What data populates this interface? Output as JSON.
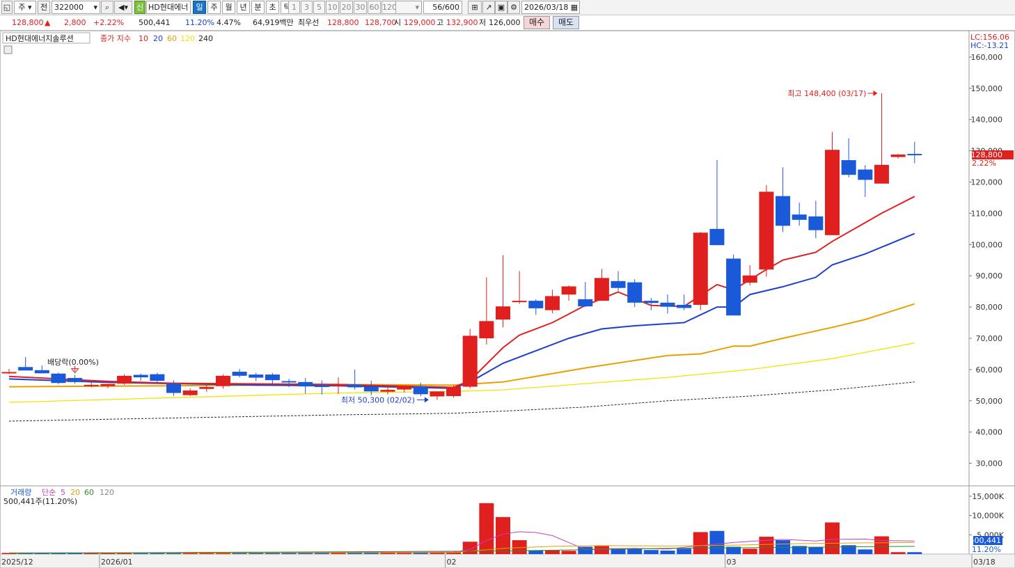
{
  "toolbar": {
    "market": "주",
    "prev_label": "전",
    "code": "322000",
    "new_badge": "신",
    "stock_name": "HD현대에너",
    "periods": [
      "일",
      "주",
      "월",
      "년",
      "분",
      "초",
      "틱"
    ],
    "active_period": "일",
    "intervals": [
      "1",
      "3",
      "5",
      "10",
      "20",
      "30",
      "60",
      "120"
    ],
    "count": "56/600",
    "date": "2026/03/18"
  },
  "quote": {
    "price": "128,800",
    "change": "2,800",
    "change_pct": "+2.22%",
    "volume": "500,441",
    "turnover_pct": "11.20%",
    "other_pct": "4.47%",
    "amount": "64,919백만",
    "best_bid_label": "최우선",
    "best_ask": "128,800",
    "best_bid": "128,700",
    "open_label": "시",
    "open": "129,000",
    "high_label": "고",
    "high": "132,900",
    "low_label": "저",
    "low": "126,000",
    "buy_label": "매수",
    "sell_label": "매도"
  },
  "chart_data": {
    "type": "candlestick",
    "title": "HD현대에너지솔루션",
    "ma_label": "종가 지수",
    "ma_periods": [
      "10",
      "20",
      "60",
      "120",
      "240"
    ],
    "ma_colors": [
      "#e0201e",
      "#1d3fd0",
      "#e8a000",
      "#f2e400",
      "#222222"
    ],
    "lc_label": "LC:156.06",
    "hc_label": "HC:-13.21",
    "current_price_label": "128,800",
    "current_pct_label": "2.22%",
    "y_ticks": [
      30000,
      40000,
      50000,
      60000,
      70000,
      80000,
      90000,
      100000,
      110000,
      120000,
      130000,
      140000,
      150000,
      160000
    ],
    "y_tick_labels": [
      "30,000",
      "40,000",
      "50,000",
      "60,000",
      "70,000",
      "80,000",
      "90,000",
      "100,000",
      "110,000",
      "120,000",
      "130,000",
      "140,000",
      "150,000",
      "160,000"
    ],
    "ylim": [
      23000,
      168000
    ],
    "x_labels": [
      {
        "text": "2025/12",
        "idx": 0
      },
      {
        "text": "2026/01",
        "idx": 6
      },
      {
        "text": "02",
        "idx": 27
      },
      {
        "text": "03",
        "idx": 44
      },
      {
        "text": "03/18",
        "idx": 55
      }
    ],
    "candles": [
      [
        59000,
        60200,
        58600,
        59200
      ],
      [
        60800,
        64000,
        59800,
        59700
      ],
      [
        59800,
        61300,
        58800,
        58800
      ],
      [
        58700,
        59000,
        55300,
        55700
      ],
      [
        57300,
        58300,
        55500,
        56000
      ],
      [
        55100,
        56000,
        54300,
        55100
      ],
      [
        54700,
        55300,
        54000,
        55400
      ],
      [
        55500,
        58500,
        55100,
        58000
      ],
      [
        58300,
        58700,
        56400,
        57500
      ],
      [
        58500,
        59000,
        55500,
        56400
      ],
      [
        55500,
        56500,
        51600,
        52500
      ],
      [
        51800,
        54000,
        51500,
        53300
      ],
      [
        53800,
        55600,
        52800,
        54400
      ],
      [
        54700,
        58500,
        53900,
        58000
      ],
      [
        59300,
        60200,
        57500,
        58000
      ],
      [
        58400,
        59000,
        56300,
        57400
      ],
      [
        58400,
        58900,
        55500,
        56600
      ],
      [
        56300,
        57000,
        54400,
        55900
      ],
      [
        56000,
        57300,
        52300,
        54600
      ],
      [
        55000,
        56500,
        52000,
        54400
      ],
      [
        54800,
        57500,
        52200,
        55200
      ],
      [
        55200,
        60000,
        53600,
        54300
      ],
      [
        54500,
        56400,
        51800,
        53000
      ],
      [
        52900,
        55000,
        52000,
        53500
      ],
      [
        53600,
        54800,
        52700,
        54600
      ],
      [
        54600,
        55800,
        51500,
        52100
      ],
      [
        51400,
        52000,
        50300,
        53000
      ],
      [
        51500,
        55000,
        51000,
        54500
      ],
      [
        54500,
        73000,
        54000,
        70800
      ],
      [
        70000,
        89500,
        68000,
        75500
      ],
      [
        76000,
        96600,
        73500,
        80200
      ],
      [
        82000,
        91500,
        81000,
        82000
      ],
      [
        82000,
        82500,
        77500,
        79600
      ],
      [
        79000,
        85500,
        78000,
        83500
      ],
      [
        84000,
        86900,
        82000,
        86600
      ],
      [
        82500,
        88000,
        80000,
        80200
      ],
      [
        82000,
        92200,
        82000,
        89300
      ],
      [
        88300,
        91500,
        85200,
        86100
      ],
      [
        87900,
        88900,
        80000,
        81400
      ],
      [
        82000,
        82900,
        79000,
        81300
      ],
      [
        81400,
        84000,
        77900,
        80100
      ],
      [
        80700,
        84000,
        79000,
        79700
      ],
      [
        80700,
        104000,
        79000,
        103800
      ],
      [
        105000,
        127000,
        104800,
        99800
      ],
      [
        95500,
        96800,
        78000,
        77300
      ],
      [
        87800,
        93400,
        86900,
        90100
      ],
      [
        92000,
        119000,
        89700,
        116900
      ],
      [
        115500,
        124700,
        104000,
        106000
      ],
      [
        109600,
        113400,
        106000,
        107900
      ],
      [
        109000,
        114000,
        102000,
        104600
      ],
      [
        103000,
        136000,
        103000,
        130300
      ],
      [
        127000,
        134000,
        121500,
        122300
      ],
      [
        124000,
        125400,
        115200,
        120700
      ],
      [
        119500,
        148400,
        119500,
        125500
      ],
      [
        128000,
        129000,
        127500,
        128800
      ],
      [
        129000,
        132900,
        126000,
        128800
      ]
    ],
    "ma_lines": {
      "10": [
        [
          0,
          57800
        ],
        [
          6,
          56200
        ],
        [
          10,
          55600
        ],
        [
          15,
          55400
        ],
        [
          20,
          55200
        ],
        [
          27,
          54300
        ],
        [
          28,
          56500
        ],
        [
          30,
          67000
        ],
        [
          31,
          71000
        ],
        [
          33,
          75000
        ],
        [
          35,
          80500
        ],
        [
          37,
          84800
        ],
        [
          39,
          80500
        ],
        [
          41,
          80200
        ],
        [
          43,
          87200
        ],
        [
          44,
          85500
        ],
        [
          46,
          92000
        ],
        [
          47,
          95000
        ],
        [
          49,
          97500
        ],
        [
          50,
          101000
        ],
        [
          52,
          107000
        ],
        [
          53,
          110000
        ],
        [
          55,
          115400
        ]
      ],
      "20": [
        [
          0,
          57000
        ],
        [
          6,
          55900
        ],
        [
          10,
          55500
        ],
        [
          15,
          55000
        ],
        [
          20,
          54800
        ],
        [
          27,
          54000
        ],
        [
          28,
          56000
        ],
        [
          30,
          62000
        ],
        [
          32,
          66000
        ],
        [
          34,
          70000
        ],
        [
          36,
          73000
        ],
        [
          38,
          74000
        ],
        [
          41,
          75000
        ],
        [
          43,
          80000
        ],
        [
          44,
          80000
        ],
        [
          45,
          84000
        ],
        [
          47,
          86500
        ],
        [
          49,
          89500
        ],
        [
          50,
          93500
        ],
        [
          52,
          97000
        ],
        [
          55,
          103500
        ]
      ],
      "60": [
        [
          0,
          54500
        ],
        [
          10,
          54800
        ],
        [
          20,
          55200
        ],
        [
          27,
          55000
        ],
        [
          30,
          56000
        ],
        [
          35,
          60500
        ],
        [
          40,
          64500
        ],
        [
          42,
          65000
        ],
        [
          44,
          67500
        ],
        [
          45,
          67500
        ],
        [
          47,
          70000
        ],
        [
          50,
          73500
        ],
        [
          52,
          76000
        ],
        [
          55,
          81000
        ]
      ],
      "120": [
        [
          0,
          49500
        ],
        [
          10,
          51000
        ],
        [
          20,
          52500
        ],
        [
          27,
          53000
        ],
        [
          30,
          53500
        ],
        [
          35,
          55500
        ],
        [
          40,
          57500
        ],
        [
          45,
          60000
        ],
        [
          50,
          63500
        ],
        [
          55,
          68500
        ]
      ],
      "240": [
        [
          0,
          43500
        ],
        [
          10,
          44500
        ],
        [
          20,
          45500
        ],
        [
          27,
          46000
        ],
        [
          30,
          46700
        ],
        [
          35,
          48000
        ],
        [
          40,
          50000
        ],
        [
          45,
          51500
        ],
        [
          50,
          53500
        ],
        [
          55,
          56000
        ]
      ]
    },
    "annotations": {
      "high": "최고 148,400 (03/17)",
      "low": "최저 50,300 (02/02)",
      "dividend": "배당락(0.00%)"
    },
    "volume_panel": {
      "title": "거래량",
      "ma_label": "단순",
      "ma_periods": [
        "5",
        "20",
        "60",
        "120"
      ],
      "current_label": "500,441주(11.20%)",
      "y_ticks": [
        5000,
        10000,
        15000
      ],
      "y_tick_labels": [
        "5,000K",
        "10,000K",
        "15,000K"
      ],
      "current_value_label": "500,441",
      "current_pct_label": "11.20%",
      "ylim": [
        0,
        17500
      ],
      "volumes": [
        300,
        350,
        300,
        280,
        250,
        260,
        240,
        320,
        280,
        300,
        400,
        350,
        300,
        450,
        300,
        280,
        300,
        280,
        420,
        350,
        400,
        500,
        360,
        330,
        300,
        420,
        520,
        430,
        3200,
        13200,
        9600,
        3600,
        1000,
        950,
        850,
        1900,
        2100,
        1500,
        1300,
        1050,
        900,
        1400,
        5700,
        6000,
        1900,
        1400,
        4500,
        3600,
        2100,
        1800,
        8200,
        2300,
        1200,
        4600,
        500,
        500
      ],
      "ma5": [
        [
          0,
          300
        ],
        [
          27,
          500
        ],
        [
          28,
          1200
        ],
        [
          29,
          3500
        ],
        [
          30,
          5200
        ],
        [
          31,
          5800
        ],
        [
          32,
          5600
        ],
        [
          33,
          4800
        ],
        [
          34,
          3000
        ],
        [
          35,
          1200
        ],
        [
          36,
          1300
        ],
        [
          38,
          1500
        ],
        [
          40,
          1300
        ],
        [
          42,
          2200
        ],
        [
          44,
          3000
        ],
        [
          45,
          3300
        ],
        [
          47,
          3800
        ],
        [
          49,
          3400
        ],
        [
          50,
          3800
        ],
        [
          52,
          3900
        ],
        [
          53,
          3500
        ],
        [
          55,
          3400
        ]
      ],
      "ma20": [
        [
          0,
          250
        ],
        [
          27,
          400
        ],
        [
          30,
          1500
        ],
        [
          33,
          2000
        ],
        [
          36,
          2200
        ],
        [
          40,
          2100
        ],
        [
          44,
          2300
        ],
        [
          48,
          2700
        ],
        [
          52,
          2900
        ],
        [
          55,
          3000
        ]
      ],
      "ma60": [
        [
          0,
          200
        ],
        [
          30,
          800
        ],
        [
          40,
          1500
        ],
        [
          55,
          2000
        ]
      ]
    }
  }
}
